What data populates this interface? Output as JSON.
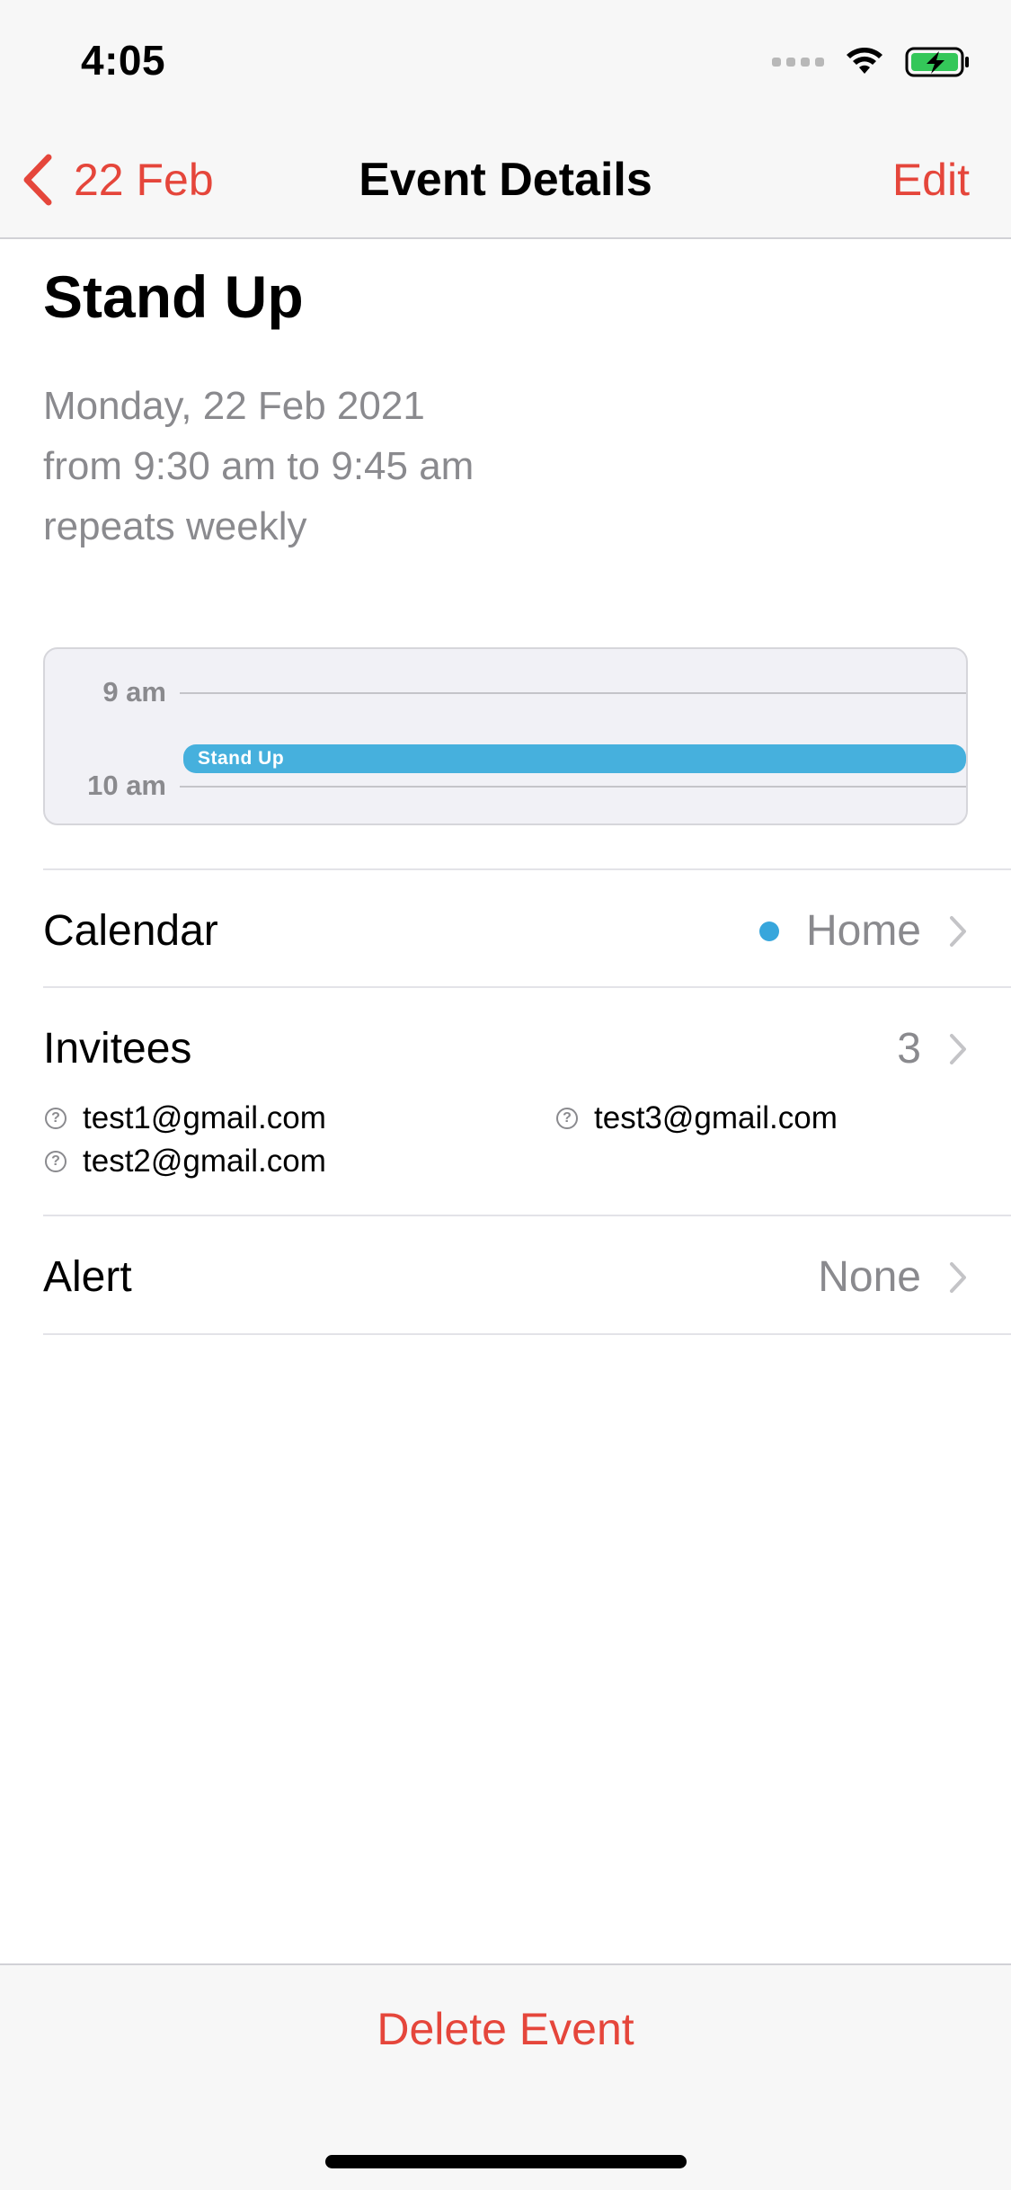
{
  "status_bar": {
    "time": "4:05",
    "icons": [
      "cellular-signal-icon",
      "wifi-icon",
      "battery-charging-icon"
    ]
  },
  "nav": {
    "back_label": "22 Feb",
    "title": "Event Details",
    "edit_label": "Edit"
  },
  "event": {
    "title": "Stand Up",
    "date_line": "Monday, 22 Feb 2021",
    "time_line": "from 9:30 am to 9:45 am",
    "repeat_line": "repeats weekly"
  },
  "timeline": {
    "hour_labels": [
      "9 am",
      "10 am"
    ],
    "event_label": "Stand Up",
    "event_color": "#46b0dd"
  },
  "calendar_row": {
    "label": "Calendar",
    "value": "Home",
    "dot_color": "#37a6dc"
  },
  "invitees_row": {
    "label": "Invitees",
    "count": "3",
    "people": [
      "test1@gmail.com",
      "test2@gmail.com",
      "test3@gmail.com"
    ],
    "status_icon": "question-circle-icon"
  },
  "alert_row": {
    "label": "Alert",
    "value": "None"
  },
  "toolbar": {
    "delete_label": "Delete Event"
  },
  "colors": {
    "accent": "#e5463b",
    "secondary_text": "#8a8a8e",
    "calendar_blue": "#37a6dc"
  }
}
